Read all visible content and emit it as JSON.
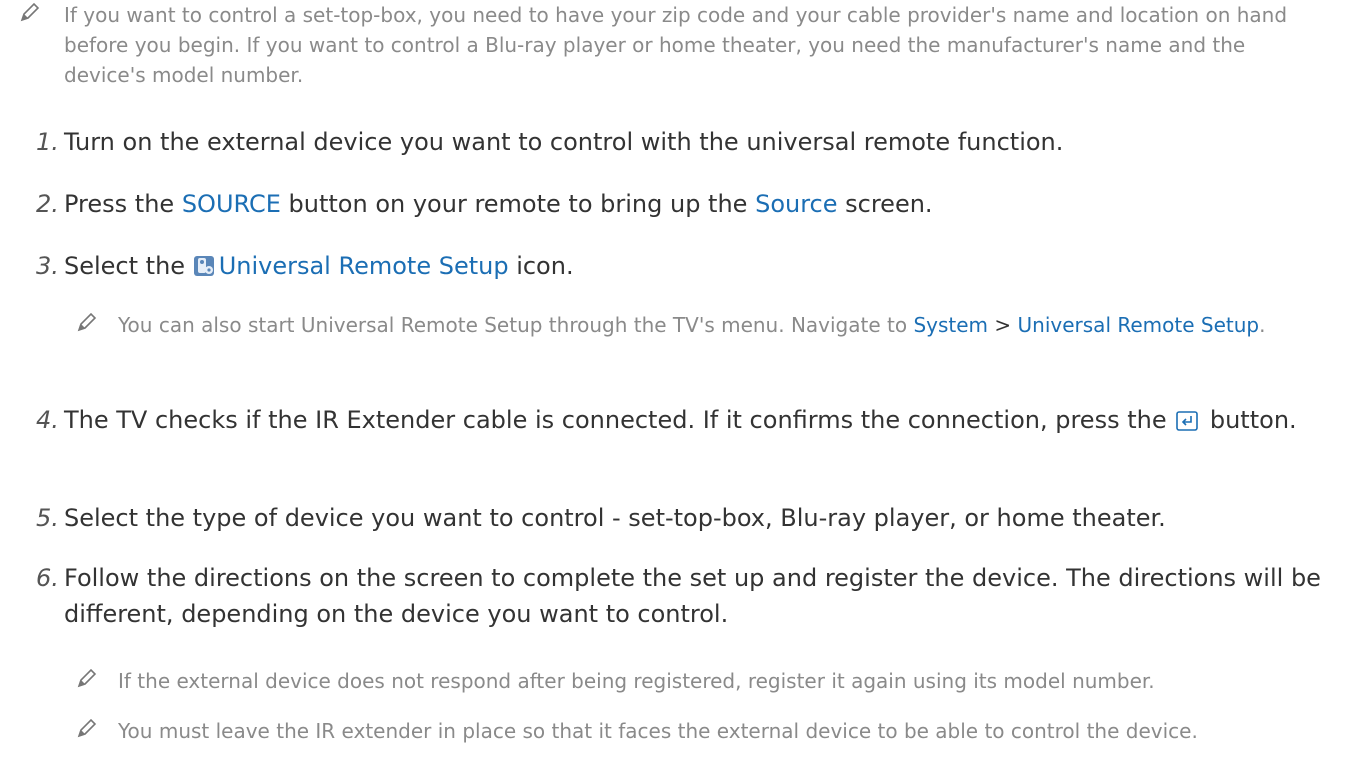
{
  "intro_note": {
    "text": "If you want to control a set-top-box, you need to have your zip code and your cable provider's name and location on hand before you begin. If you want to control a Blu-ray player or home theater, you need the manufacturer's name and the device's model number."
  },
  "steps": [
    {
      "number": "1.",
      "text": "Turn on the external device you want to control with the universal remote function."
    },
    {
      "number": "2.",
      "pre": "Press the ",
      "hl1": "SOURCE",
      "mid": " button on your remote to bring up the ",
      "hl2": "Source",
      "post": " screen."
    },
    {
      "number": "3.",
      "pre": "Select the ",
      "hl1": "Universal Remote Setup",
      "post": " icon.",
      "icon": "universal-remote-setup-icon"
    },
    {
      "number": "4.",
      "pre": "The TV checks if the IR Extender cable is connected. If it confirms the connection, press the ",
      "post": " button.",
      "icon": "enter-icon"
    },
    {
      "number": "5.",
      "text": "Select the type of device you want to control - set-top-box, Blu-ray player, or home theater."
    },
    {
      "number": "6.",
      "text": "Follow the directions on the screen to complete the set up and register the device. The directions will be different, depending on the device you want to control."
    }
  ],
  "step3_note": {
    "pre": "You can also start Universal Remote Setup through the TV's menu. Navigate to ",
    "hl1": "System",
    "sep": " > ",
    "hl2": "Universal Remote Setup",
    "post": "."
  },
  "step6_notes": [
    "If the external device does not respond after being registered, register it again using its model number.",
    "You must leave the IR extender in place so that it faces the external device to be able to control the device."
  ],
  "icons": {
    "note": "pencil-icon"
  },
  "colors": {
    "highlight": "#1b6eb4",
    "note_text": "#8a8a8a",
    "body_text": "#333333"
  }
}
